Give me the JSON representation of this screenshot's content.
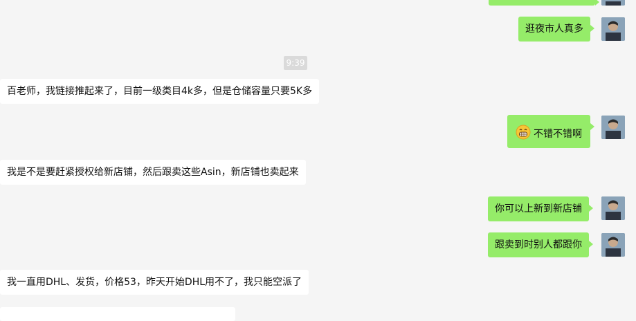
{
  "chat": {
    "messages": [
      {
        "id": "m0",
        "side": "out",
        "text": ""
      },
      {
        "id": "m1",
        "side": "out",
        "text": "逛夜市人真多"
      },
      {
        "id": "t1",
        "side": "time",
        "text": "9:39"
      },
      {
        "id": "m2",
        "side": "in",
        "text": "百老师，我链接推起来了，目前一级类目4k多，但是仓储容量只要5K多"
      },
      {
        "id": "m3",
        "side": "out",
        "text": "不错不错啊",
        "emoji": "grinning-face-icon"
      },
      {
        "id": "m4",
        "side": "in",
        "text": "我是不是要赶紧授权给新店铺，然后跟卖这些Asin，新店铺也卖起来"
      },
      {
        "id": "m5",
        "side": "out",
        "text": "你可以上新到新店铺"
      },
      {
        "id": "m6",
        "side": "out",
        "text": "跟卖到时别人都跟你"
      },
      {
        "id": "m7",
        "side": "in",
        "text": "我一直用DHL、发货，价格53，昨天开始DHL用不了，我只能空派了"
      },
      {
        "id": "m8",
        "side": "in",
        "text": ""
      }
    ]
  },
  "colors": {
    "background": "#f5f5f5",
    "incoming_bubble": "#ffffff",
    "outgoing_bubble": "#95ec69",
    "timestamp_bg": "#dadada"
  }
}
